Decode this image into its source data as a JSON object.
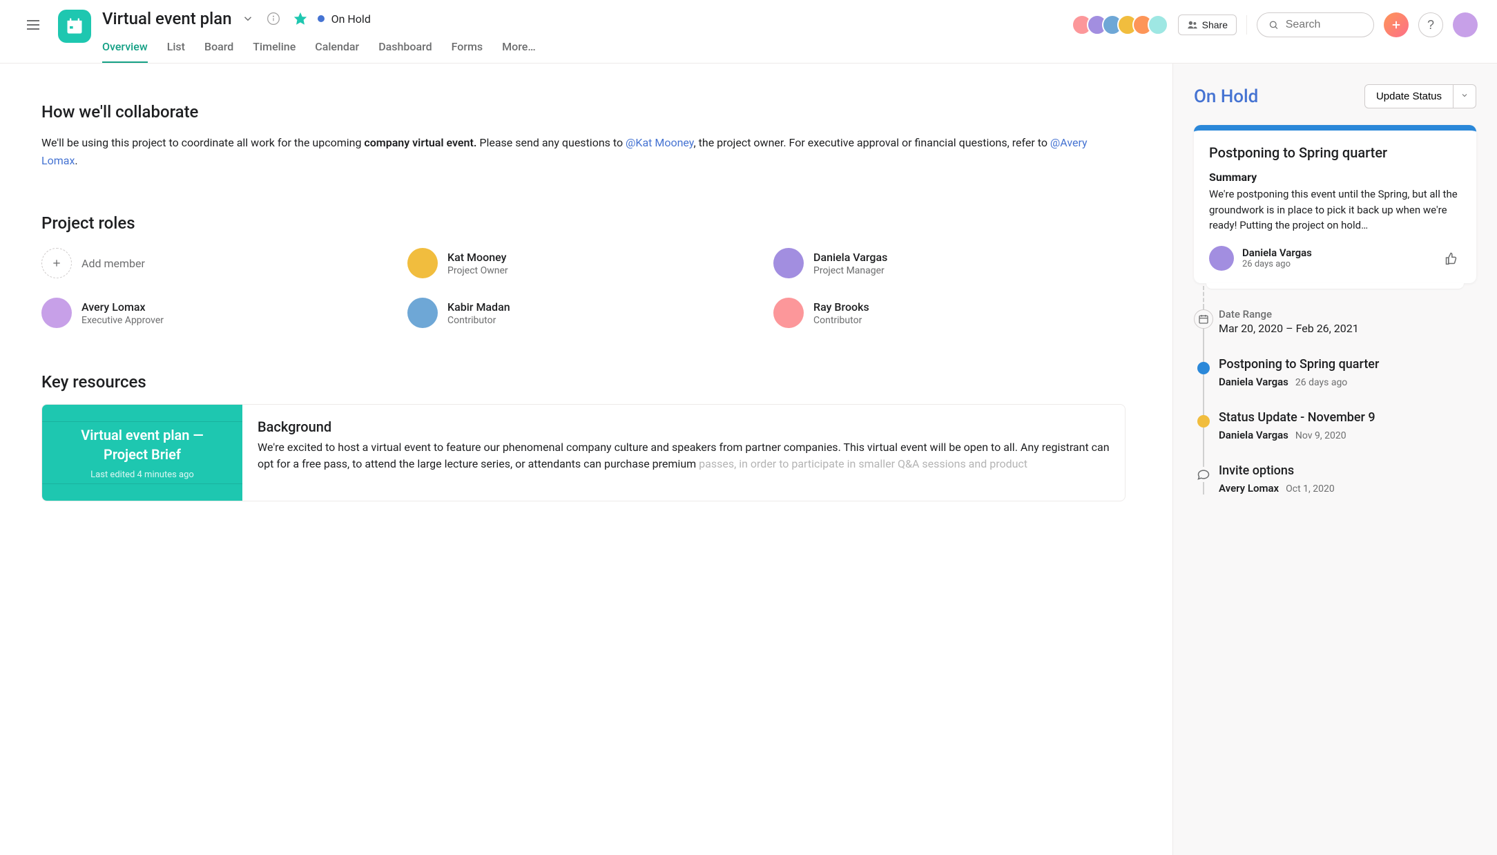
{
  "header": {
    "project_title": "Virtual event plan",
    "status_label": "On Hold",
    "tabs": [
      "Overview",
      "List",
      "Board",
      "Timeline",
      "Calendar",
      "Dashboard",
      "Forms",
      "More…"
    ],
    "share_label": "Share",
    "search_placeholder": "Search",
    "avatar_colors": [
      "#fc979a",
      "#a28ee0",
      "#6ea7d6",
      "#f1bd3e",
      "#fd9558",
      "#9ee7e3"
    ]
  },
  "collaborate": {
    "heading": "How we'll collaborate",
    "text_1": "We'll be using this project to coordinate all work for the upcoming ",
    "text_bold": "company virtual event.",
    "text_2": " Please send any questions to ",
    "mention_1": "@Kat Mooney",
    "text_3": ", the project owner. For executive approval or financial questions, refer to ",
    "mention_2": "@Avery Lomax",
    "text_4": "."
  },
  "roles": {
    "heading": "Project roles",
    "add_label": "Add member",
    "members": [
      {
        "name": "Kat Mooney",
        "role": "Project Owner",
        "color": "#f1bd3e"
      },
      {
        "name": "Daniela Vargas",
        "role": "Project Manager",
        "color": "#a28ee0"
      },
      {
        "name": "Avery Lomax",
        "role": "Executive Approver",
        "color": "#c7a0e8"
      },
      {
        "name": "Kabir Madan",
        "role": "Contributor",
        "color": "#6ea7d6"
      },
      {
        "name": "Ray Brooks",
        "role": "Contributor",
        "color": "#fc979a"
      }
    ]
  },
  "resources": {
    "heading": "Key resources",
    "card_title": "Virtual event plan — Project Brief",
    "card_sub": "Last edited 4 minutes ago",
    "bg_heading": "Background",
    "bg_text": "We're excited to host a virtual event to feature our phenomenal company culture and speakers from partner companies. This virtual event will be open to all. Any registrant can opt for a free pass, to attend the large lecture series, or attendants can purchase premium ",
    "bg_fade": "passes, in order to participate in smaller Q&A sessions and product"
  },
  "right": {
    "status_title": "On Hold",
    "update_label": "Update Status",
    "card": {
      "title": "Postponing to Spring quarter",
      "summary_label": "Summary",
      "body": "We're postponing this event until the Spring, but all the groundwork is in place to pick it back up when we're ready! Putting the project on hold…",
      "author": "Daniela Vargas",
      "time": "26 days ago",
      "author_color": "#a28ee0"
    },
    "date_range": {
      "label": "Date Range",
      "value": "Mar 20, 2020 – Feb 26, 2021"
    },
    "timeline": [
      {
        "type": "blue",
        "title": "Postponing to Spring quarter",
        "author": "Daniela Vargas",
        "time": "26 days ago"
      },
      {
        "type": "yellow",
        "title": "Status Update - November 9",
        "author": "Daniela Vargas",
        "time": "Nov 9, 2020"
      },
      {
        "type": "comment",
        "title": "Invite options",
        "author": "Avery Lomax",
        "time": "Oct 1, 2020"
      }
    ]
  }
}
